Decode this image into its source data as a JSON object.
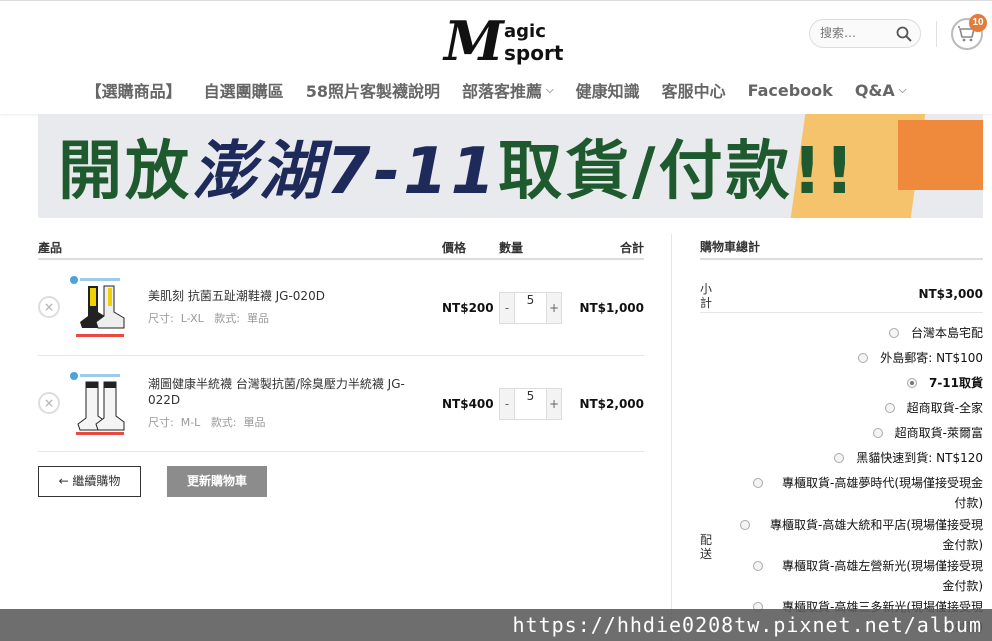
{
  "header": {
    "logo": {
      "m": "M",
      "line1": "agic",
      "line2": "sport"
    },
    "search_placeholder": "搜索…",
    "cart_count": "10"
  },
  "nav": [
    {
      "label": "【選購商品】",
      "dropdown": false
    },
    {
      "label": "自選團購區",
      "dropdown": false
    },
    {
      "label": "58照片客製襪說明",
      "dropdown": false
    },
    {
      "label": "部落客推薦",
      "dropdown": true
    },
    {
      "label": "健康知識",
      "dropdown": false
    },
    {
      "label": "客服中心",
      "dropdown": false
    },
    {
      "label": "Facebook",
      "dropdown": false
    },
    {
      "label": "Q&A",
      "dropdown": true
    }
  ],
  "banner": {
    "part1": "開放",
    "part2": "澎湖7-11",
    "part3": "取貨/付款!!"
  },
  "cart_table": {
    "headers": {
      "product": "產品",
      "price": "價格",
      "qty": "數量",
      "total": "合計"
    },
    "items": [
      {
        "name": "美肌刻 抗菌五趾潮鞋襪 JG-020D",
        "size_label": "尺寸:",
        "size": "L-XL",
        "style_label": "款式:",
        "style": "單品",
        "price": "NT$200",
        "qty": "5",
        "total": "NT$1,000"
      },
      {
        "name": "潮圖健康半統襪 台灣製抗菌/除臭壓力半統襪 JG-022D",
        "size_label": "尺寸:",
        "size": "M-L",
        "style_label": "款式:",
        "style": "單品",
        "price": "NT$400",
        "qty": "5",
        "total": "NT$2,000"
      }
    ],
    "continue_label": "← 繼續購物",
    "update_label": "更新購物車"
  },
  "cart_totals": {
    "title": "購物車總計",
    "subtotal_label": "小計",
    "subtotal_value": "NT$3,000",
    "shipping_label": "配送",
    "options": [
      {
        "label": "台灣本島宅配",
        "selected": false
      },
      {
        "label": "外島郵寄: NT$100",
        "selected": false
      },
      {
        "label": "7-11取貨",
        "selected": true
      },
      {
        "label": "超商取貨-全家",
        "selected": false
      },
      {
        "label": "超商取貨-萊爾富",
        "selected": false
      },
      {
        "label": "黑貓快速到貨: NT$120",
        "selected": false
      },
      {
        "label": "專櫃取貨-高雄夢時代(現場僅接受現金付款)",
        "selected": false
      },
      {
        "label": "專櫃取貨-高雄大統和平店(現場僅接受現金付款)",
        "selected": false
      },
      {
        "label": "專櫃取貨-高雄左營新光(現場僅接受現金付款)",
        "selected": false
      },
      {
        "label": "專櫃取貨-高雄三多新光(現場僅接受現金付款)",
        "selected": false
      }
    ]
  },
  "watermark": "https://hhdie0208tw.pixnet.net/album"
}
